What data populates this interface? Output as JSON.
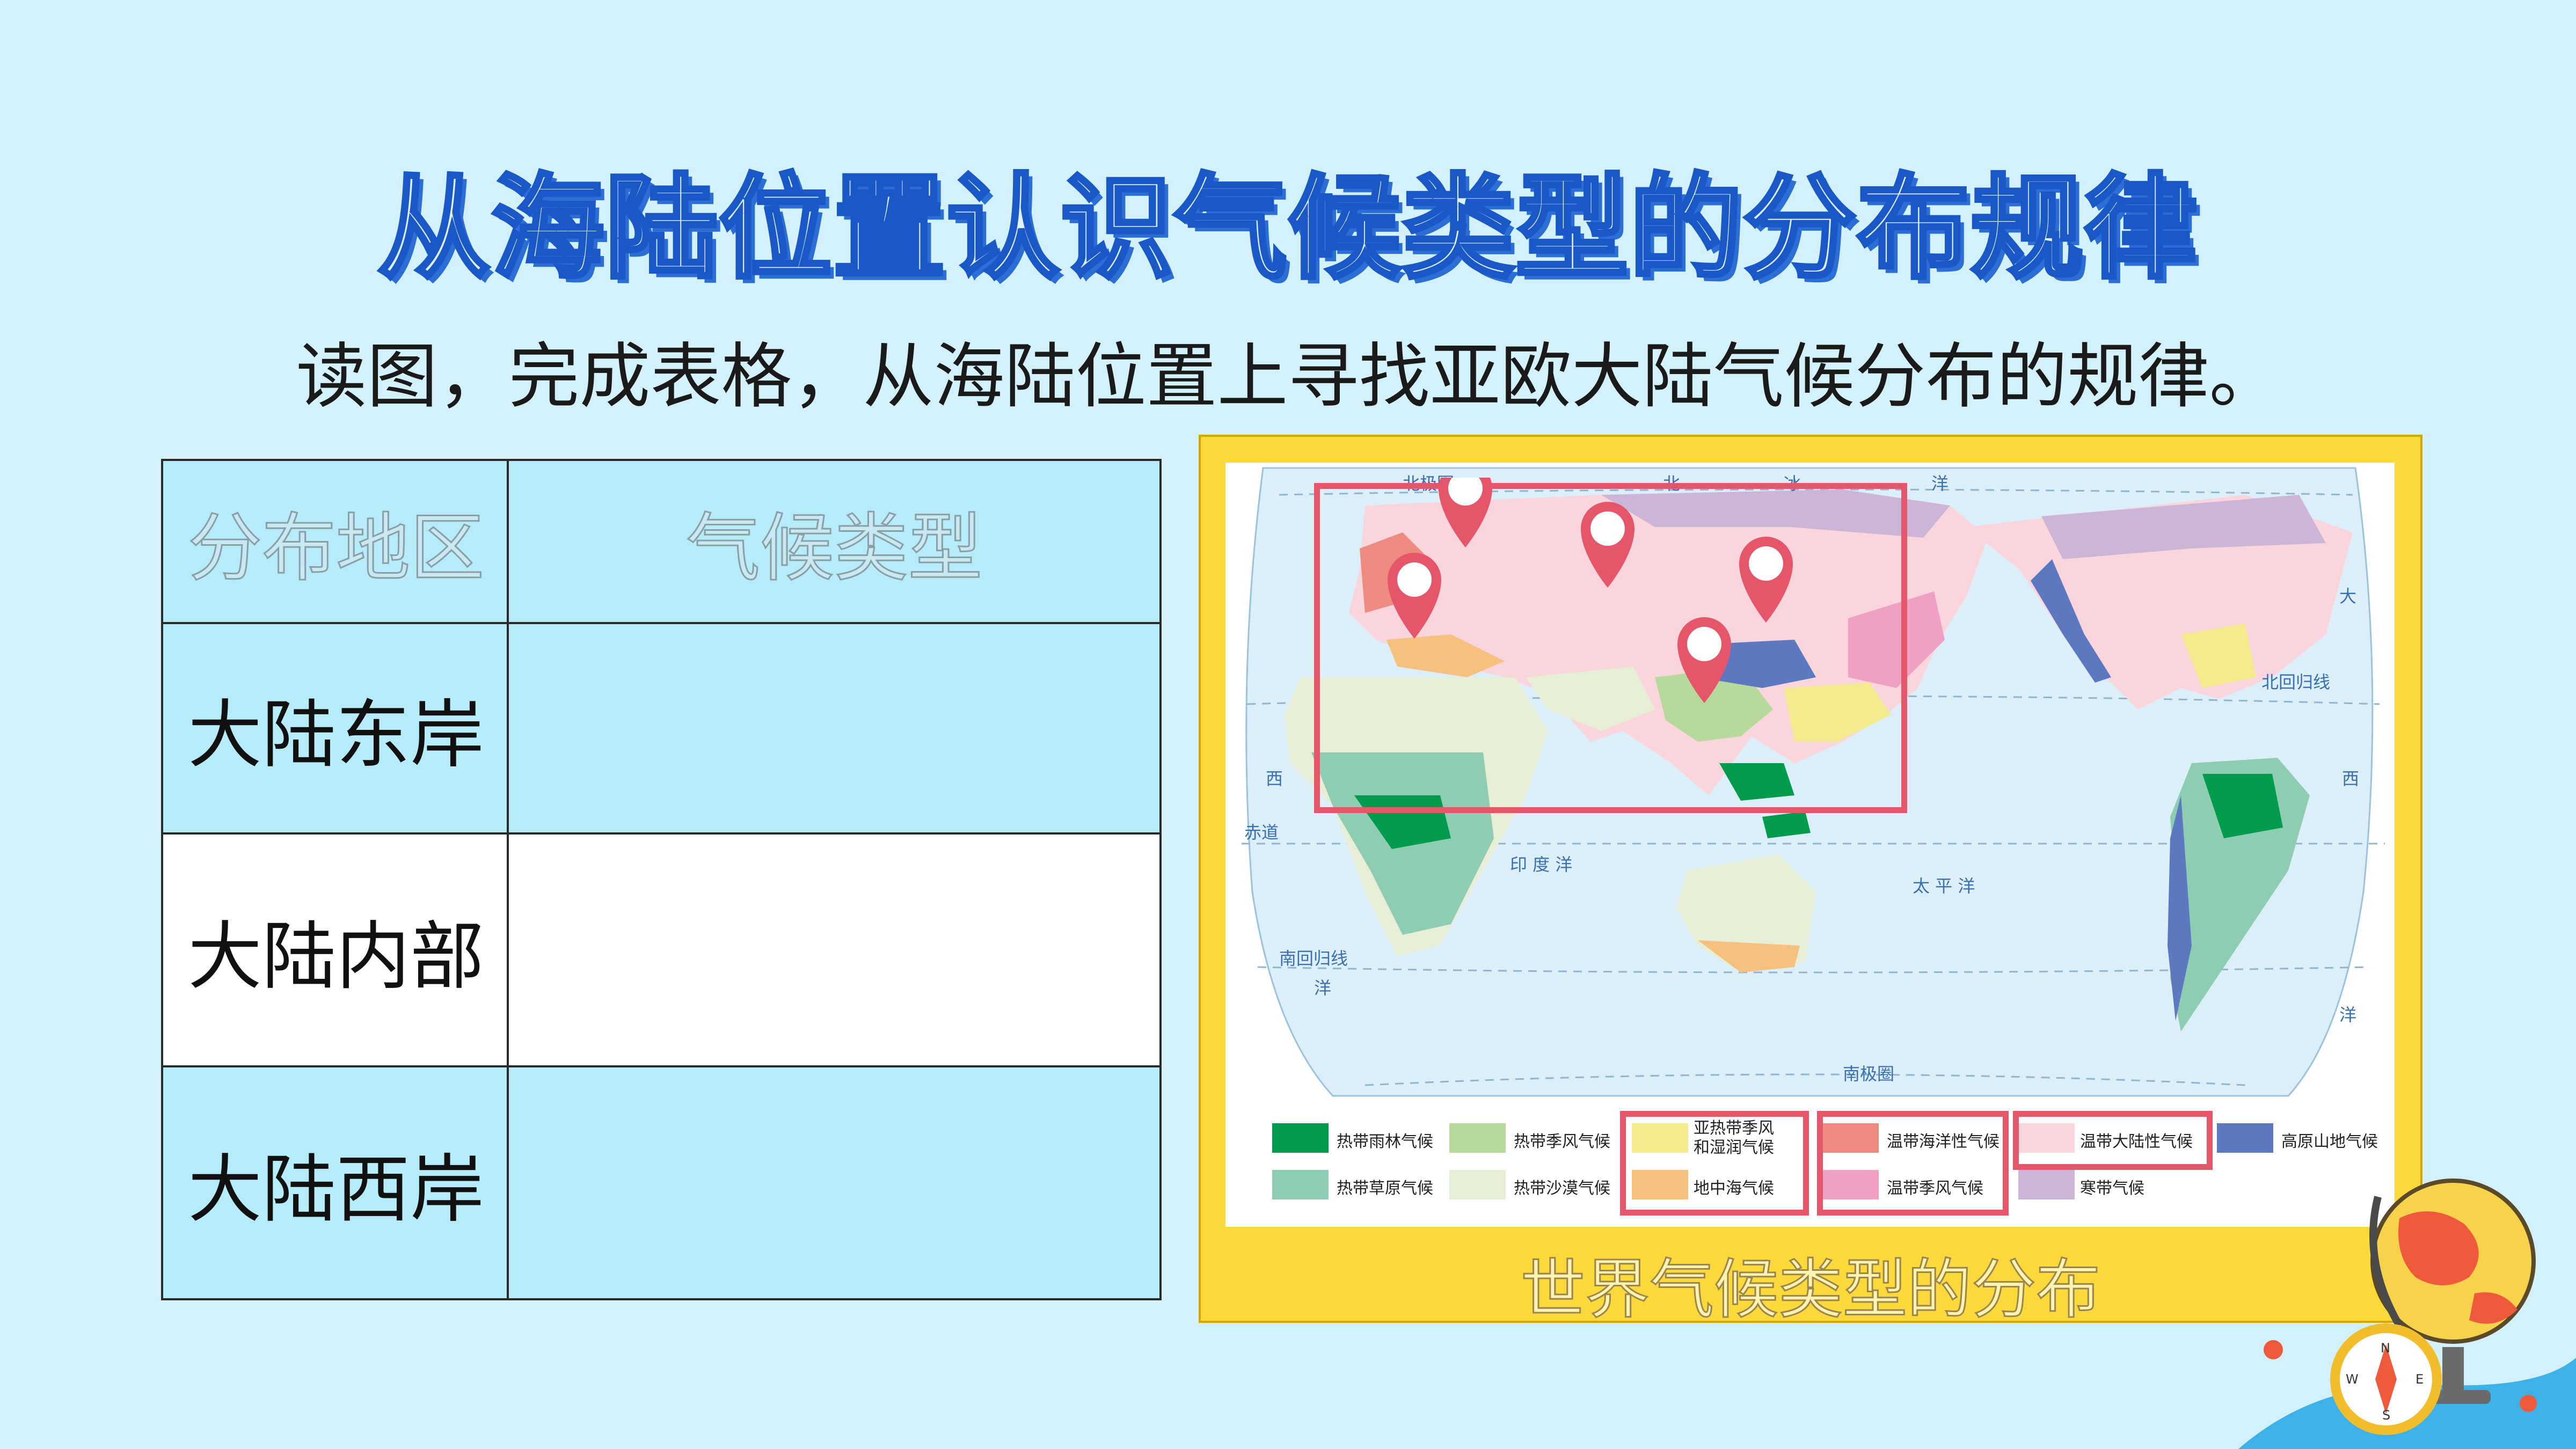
{
  "title": "从海陆位置认识气候类型的分布规律",
  "instruction": "读图，完成表格，从海陆位置上寻找亚欧大陆气候分布的规律。",
  "table": {
    "headers": [
      "分布地区",
      "气候类型"
    ],
    "rows": [
      {
        "region": "大陆东岸",
        "climate": ""
      },
      {
        "region": "大陆内部",
        "climate": ""
      },
      {
        "region": "大陆西岸",
        "climate": ""
      }
    ]
  },
  "map": {
    "caption": "世界气候类型的分布",
    "labels": {
      "arctic_circle": "北极圈",
      "antarctic_circle": "南极圈",
      "tropic_cancer": "北回归线",
      "tropic_capricorn": "南回归线",
      "equator": "赤道",
      "north": "北",
      "ice": "冰",
      "ocean": "洋",
      "big": "大",
      "west": "西",
      "indian_ocean": "印 度 洋",
      "pacific": "太 平 洋"
    },
    "legend": [
      {
        "label": "热带雨林气候",
        "color": "#009b4c"
      },
      {
        "label": "热带季风气候",
        "color": "#b8d99c"
      },
      {
        "label": "亚热带季风和湿润气候",
        "line1": "亚热带季风",
        "line2": "和湿润气候",
        "color": "#f3eb8e"
      },
      {
        "label": "温带海洋性气候",
        "color": "#ee8b80"
      },
      {
        "label": "温带大陆性气候",
        "color": "#fbd5dc"
      },
      {
        "label": "高原山地气候",
        "color": "#5b78c0"
      },
      {
        "label": "热带草原气候",
        "color": "#8fcdb3"
      },
      {
        "label": "热带沙漠气候",
        "color": "#e6eed6"
      },
      {
        "label": "地中海气候",
        "color": "#f6c07d"
      },
      {
        "label": "温带季风气候",
        "color": "#f0a0c2"
      },
      {
        "label": "寒带气候",
        "color": "#cdb5d8"
      }
    ]
  },
  "colors": {
    "background": "#d3f1fb",
    "title_stroke": "#1a58c8",
    "frame": "#fcd93b",
    "highlight": "#e5566a",
    "table_fill": "#b6ecfa"
  }
}
